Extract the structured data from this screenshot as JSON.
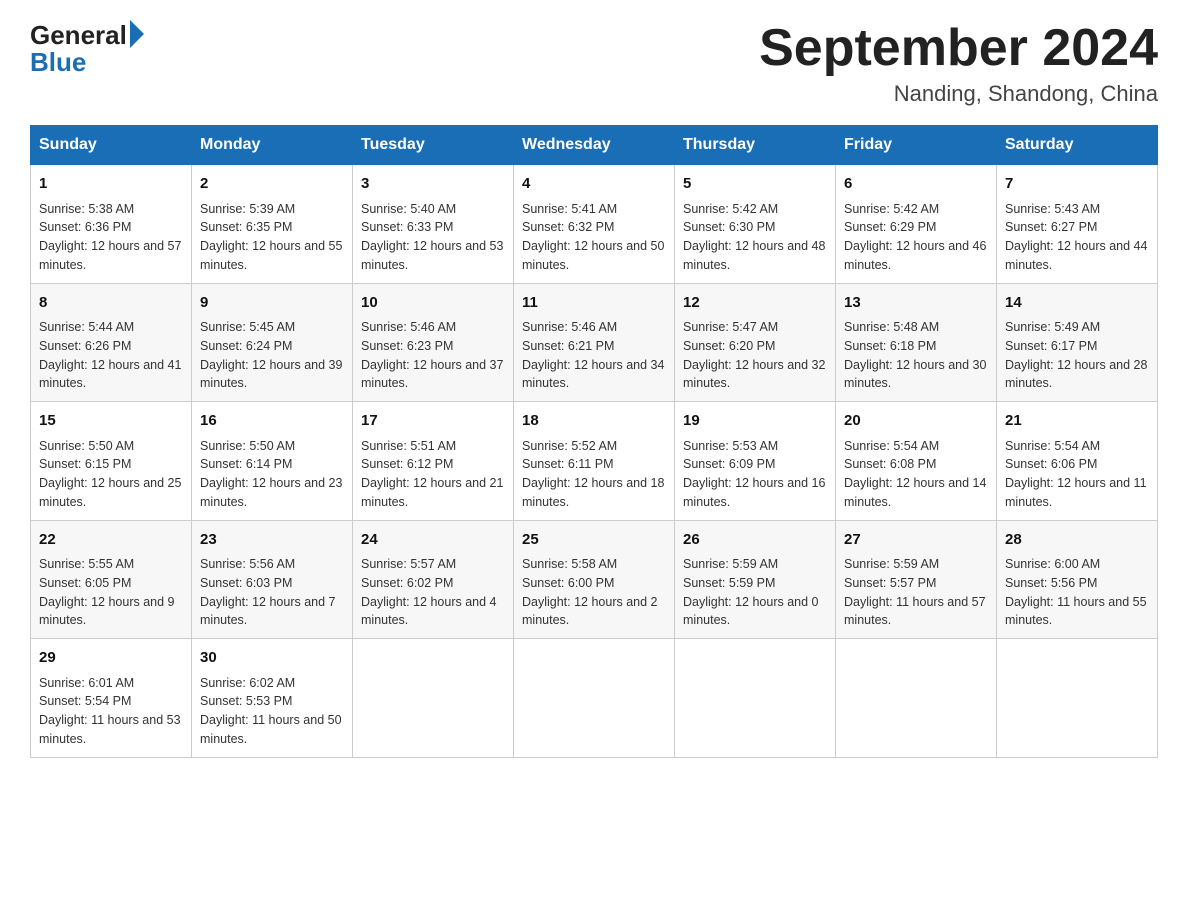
{
  "logo": {
    "general": "General",
    "blue": "Blue"
  },
  "title": {
    "month_year": "September 2024",
    "location": "Nanding, Shandong, China"
  },
  "header": {
    "days": [
      "Sunday",
      "Monday",
      "Tuesday",
      "Wednesday",
      "Thursday",
      "Friday",
      "Saturday"
    ]
  },
  "weeks": [
    [
      {
        "day": "1",
        "sunrise": "5:38 AM",
        "sunset": "6:36 PM",
        "daylight": "12 hours and 57 minutes."
      },
      {
        "day": "2",
        "sunrise": "5:39 AM",
        "sunset": "6:35 PM",
        "daylight": "12 hours and 55 minutes."
      },
      {
        "day": "3",
        "sunrise": "5:40 AM",
        "sunset": "6:33 PM",
        "daylight": "12 hours and 53 minutes."
      },
      {
        "day": "4",
        "sunrise": "5:41 AM",
        "sunset": "6:32 PM",
        "daylight": "12 hours and 50 minutes."
      },
      {
        "day": "5",
        "sunrise": "5:42 AM",
        "sunset": "6:30 PM",
        "daylight": "12 hours and 48 minutes."
      },
      {
        "day": "6",
        "sunrise": "5:42 AM",
        "sunset": "6:29 PM",
        "daylight": "12 hours and 46 minutes."
      },
      {
        "day": "7",
        "sunrise": "5:43 AM",
        "sunset": "6:27 PM",
        "daylight": "12 hours and 44 minutes."
      }
    ],
    [
      {
        "day": "8",
        "sunrise": "5:44 AM",
        "sunset": "6:26 PM",
        "daylight": "12 hours and 41 minutes."
      },
      {
        "day": "9",
        "sunrise": "5:45 AM",
        "sunset": "6:24 PM",
        "daylight": "12 hours and 39 minutes."
      },
      {
        "day": "10",
        "sunrise": "5:46 AM",
        "sunset": "6:23 PM",
        "daylight": "12 hours and 37 minutes."
      },
      {
        "day": "11",
        "sunrise": "5:46 AM",
        "sunset": "6:21 PM",
        "daylight": "12 hours and 34 minutes."
      },
      {
        "day": "12",
        "sunrise": "5:47 AM",
        "sunset": "6:20 PM",
        "daylight": "12 hours and 32 minutes."
      },
      {
        "day": "13",
        "sunrise": "5:48 AM",
        "sunset": "6:18 PM",
        "daylight": "12 hours and 30 minutes."
      },
      {
        "day": "14",
        "sunrise": "5:49 AM",
        "sunset": "6:17 PM",
        "daylight": "12 hours and 28 minutes."
      }
    ],
    [
      {
        "day": "15",
        "sunrise": "5:50 AM",
        "sunset": "6:15 PM",
        "daylight": "12 hours and 25 minutes."
      },
      {
        "day": "16",
        "sunrise": "5:50 AM",
        "sunset": "6:14 PM",
        "daylight": "12 hours and 23 minutes."
      },
      {
        "day": "17",
        "sunrise": "5:51 AM",
        "sunset": "6:12 PM",
        "daylight": "12 hours and 21 minutes."
      },
      {
        "day": "18",
        "sunrise": "5:52 AM",
        "sunset": "6:11 PM",
        "daylight": "12 hours and 18 minutes."
      },
      {
        "day": "19",
        "sunrise": "5:53 AM",
        "sunset": "6:09 PM",
        "daylight": "12 hours and 16 minutes."
      },
      {
        "day": "20",
        "sunrise": "5:54 AM",
        "sunset": "6:08 PM",
        "daylight": "12 hours and 14 minutes."
      },
      {
        "day": "21",
        "sunrise": "5:54 AM",
        "sunset": "6:06 PM",
        "daylight": "12 hours and 11 minutes."
      }
    ],
    [
      {
        "day": "22",
        "sunrise": "5:55 AM",
        "sunset": "6:05 PM",
        "daylight": "12 hours and 9 minutes."
      },
      {
        "day": "23",
        "sunrise": "5:56 AM",
        "sunset": "6:03 PM",
        "daylight": "12 hours and 7 minutes."
      },
      {
        "day": "24",
        "sunrise": "5:57 AM",
        "sunset": "6:02 PM",
        "daylight": "12 hours and 4 minutes."
      },
      {
        "day": "25",
        "sunrise": "5:58 AM",
        "sunset": "6:00 PM",
        "daylight": "12 hours and 2 minutes."
      },
      {
        "day": "26",
        "sunrise": "5:59 AM",
        "sunset": "5:59 PM",
        "daylight": "12 hours and 0 minutes."
      },
      {
        "day": "27",
        "sunrise": "5:59 AM",
        "sunset": "5:57 PM",
        "daylight": "11 hours and 57 minutes."
      },
      {
        "day": "28",
        "sunrise": "6:00 AM",
        "sunset": "5:56 PM",
        "daylight": "11 hours and 55 minutes."
      }
    ],
    [
      {
        "day": "29",
        "sunrise": "6:01 AM",
        "sunset": "5:54 PM",
        "daylight": "11 hours and 53 minutes."
      },
      {
        "day": "30",
        "sunrise": "6:02 AM",
        "sunset": "5:53 PM",
        "daylight": "11 hours and 50 minutes."
      },
      null,
      null,
      null,
      null,
      null
    ]
  ]
}
